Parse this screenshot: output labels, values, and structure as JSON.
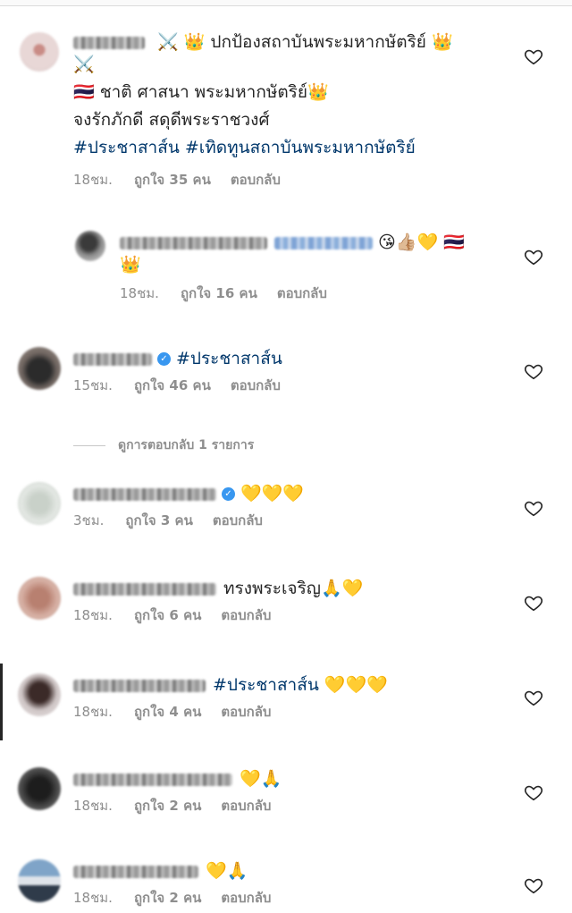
{
  "comments": [
    {
      "line1": " ⚔️ 👑 ปกป้องสถาบันพระมหากษัตริย์ 👑",
      "line1b": "⚔️",
      "line2": "🇹🇭 ชาติ ศาสนา พระมหากษัตริย์👑",
      "line3": "จงรักภักดี สดุดีพระราชวงศ์",
      "line4": "#ประชาสาส์น #เทิดทูนสถาบันพระมหากษัตริย์",
      "time": "18ชม.",
      "likes": "ถูกใจ 35 คน",
      "reply": "ตอบกลับ"
    },
    {
      "line1": "😘👍🏼💛 🇹🇭",
      "line1b": "👑",
      "time": "18ชม.",
      "likes": "ถูกใจ 16 คน",
      "reply": "ตอบกลับ"
    },
    {
      "text": "#ประชาสาส์น",
      "time": "15ชม.",
      "likes": "ถูกใจ 46 คน",
      "reply": "ตอบกลับ"
    },
    {
      "text": "💛💛💛",
      "time": "3ชม.",
      "likes": "ถูกใจ 3 คน",
      "reply": "ตอบกลับ"
    },
    {
      "text": "ทรงพระเจริญ🙏💛",
      "time": "18ชม.",
      "likes": "ถูกใจ 6 คน",
      "reply": "ตอบกลับ"
    },
    {
      "hashtag": "#ประชาสาส์น",
      "text": " 💛💛💛",
      "time": "18ชม.",
      "likes": "ถูกใจ 4 คน",
      "reply": "ตอบกลับ"
    },
    {
      "text": "💛🙏",
      "time": "18ชม.",
      "likes": "ถูกใจ 2 คน",
      "reply": "ตอบกลับ"
    },
    {
      "text": "💛🙏",
      "time": "18ชม.",
      "likes": "ถูกใจ 2 คน",
      "reply": "ตอบกลับ"
    }
  ],
  "view_replies": "ดูการตอบกลับ 1 รายการ",
  "colors": {
    "hashtag": "#00376b",
    "meta": "#8e8e8e",
    "verified": "#3897f0"
  }
}
